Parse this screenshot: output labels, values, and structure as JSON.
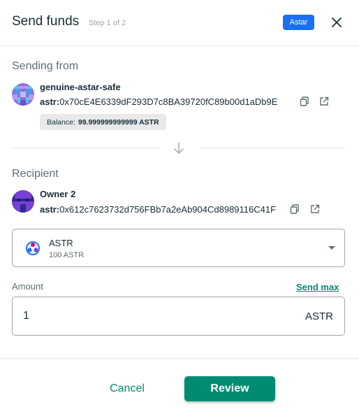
{
  "header": {
    "title": "Send funds",
    "step": "Step 1 of 2",
    "network": "Astar",
    "network_color": "#1b6ff3"
  },
  "sender": {
    "section_label": "Sending from",
    "name": "genuine-astar-safe",
    "prefix": "astr:",
    "address": "0x70cE4E6339dF293D7c8BA39720fC89b00d1aDb9E",
    "balance_label": "Balance:",
    "balance_value": "99.999999999999 ASTR",
    "avatar_icon": "identicon-purple-blue"
  },
  "recipient": {
    "section_label": "Recipient",
    "name": "Owner 2",
    "prefix": "astr:",
    "address": "0x612c7623732d756FBb7a2eAb904Cd8989116C41F",
    "avatar_icon": "identicon-navy-purple"
  },
  "token": {
    "symbol": "ASTR",
    "balance": "100 ASTR",
    "icon": "astar-logo-icon"
  },
  "amount": {
    "label": "Amount",
    "send_max": "Send max",
    "value": "1",
    "unit": "ASTR"
  },
  "actions": {
    "cancel": "Cancel",
    "review": "Review"
  },
  "colors": {
    "primary": "#008c73",
    "text": "#162d36",
    "muted": "#5d6d74"
  }
}
